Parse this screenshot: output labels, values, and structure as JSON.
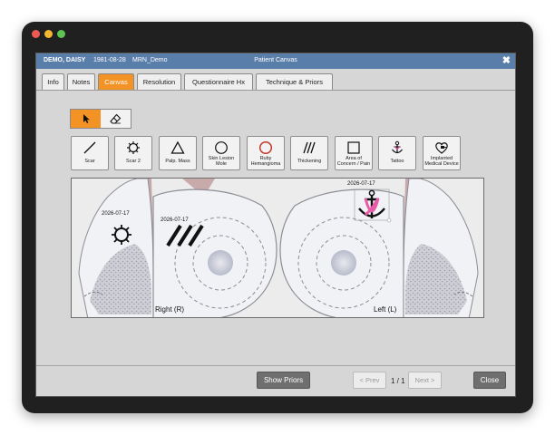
{
  "window": {
    "title": "Patient Canvas",
    "patient_name": "DEMO, DAISY",
    "dob": "1981-08-28",
    "mrn": "MRN_Demo",
    "close_glyph": "✖"
  },
  "tabs": [
    {
      "label": "Info",
      "active": false
    },
    {
      "label": "Notes",
      "active": false
    },
    {
      "label": "Canvas",
      "active": true
    },
    {
      "label": "Resolution",
      "active": false
    },
    {
      "label": "Questionnaire Hx",
      "active": false
    },
    {
      "label": "Technique & Priors",
      "active": false
    }
  ],
  "modes": [
    {
      "icon": "pointer-icon",
      "active": true
    },
    {
      "icon": "eraser-icon",
      "active": false
    }
  ],
  "tools": [
    {
      "icon": "scar-line-icon",
      "label": "Scar"
    },
    {
      "icon": "scar2-icon",
      "label": "Scar 2"
    },
    {
      "icon": "triangle-icon",
      "label": "Palp. Mass"
    },
    {
      "icon": "circle-icon",
      "label": "Skin Lesion Mole"
    },
    {
      "icon": "red-circle-icon",
      "label": "Ruby Hemangioma"
    },
    {
      "icon": "hatch-icon",
      "label": "Thickening"
    },
    {
      "icon": "square-icon",
      "label": "Area of Concern / Pain"
    },
    {
      "icon": "anchor-icon",
      "label": "Tattoo"
    },
    {
      "icon": "implant-icon",
      "label": "Implanted Medical Device"
    }
  ],
  "canvas": {
    "right_label": "Right (R)",
    "left_label": "Left (L)",
    "annotations": [
      {
        "type": "Scar 2",
        "date": "2026-07-17"
      },
      {
        "type": "Thickening",
        "date": "2026-07-17"
      },
      {
        "type": "Tattoo",
        "date": "2026-07-17"
      }
    ]
  },
  "footer": {
    "show_priors": "Show Priors",
    "prev": "< Prev",
    "page": "1 / 1",
    "next": "Next >",
    "close": "Close"
  },
  "colors": {
    "titlebar": "#5a7eaa",
    "accent": "#f39325",
    "dialog_bg": "#d6d6d6"
  }
}
